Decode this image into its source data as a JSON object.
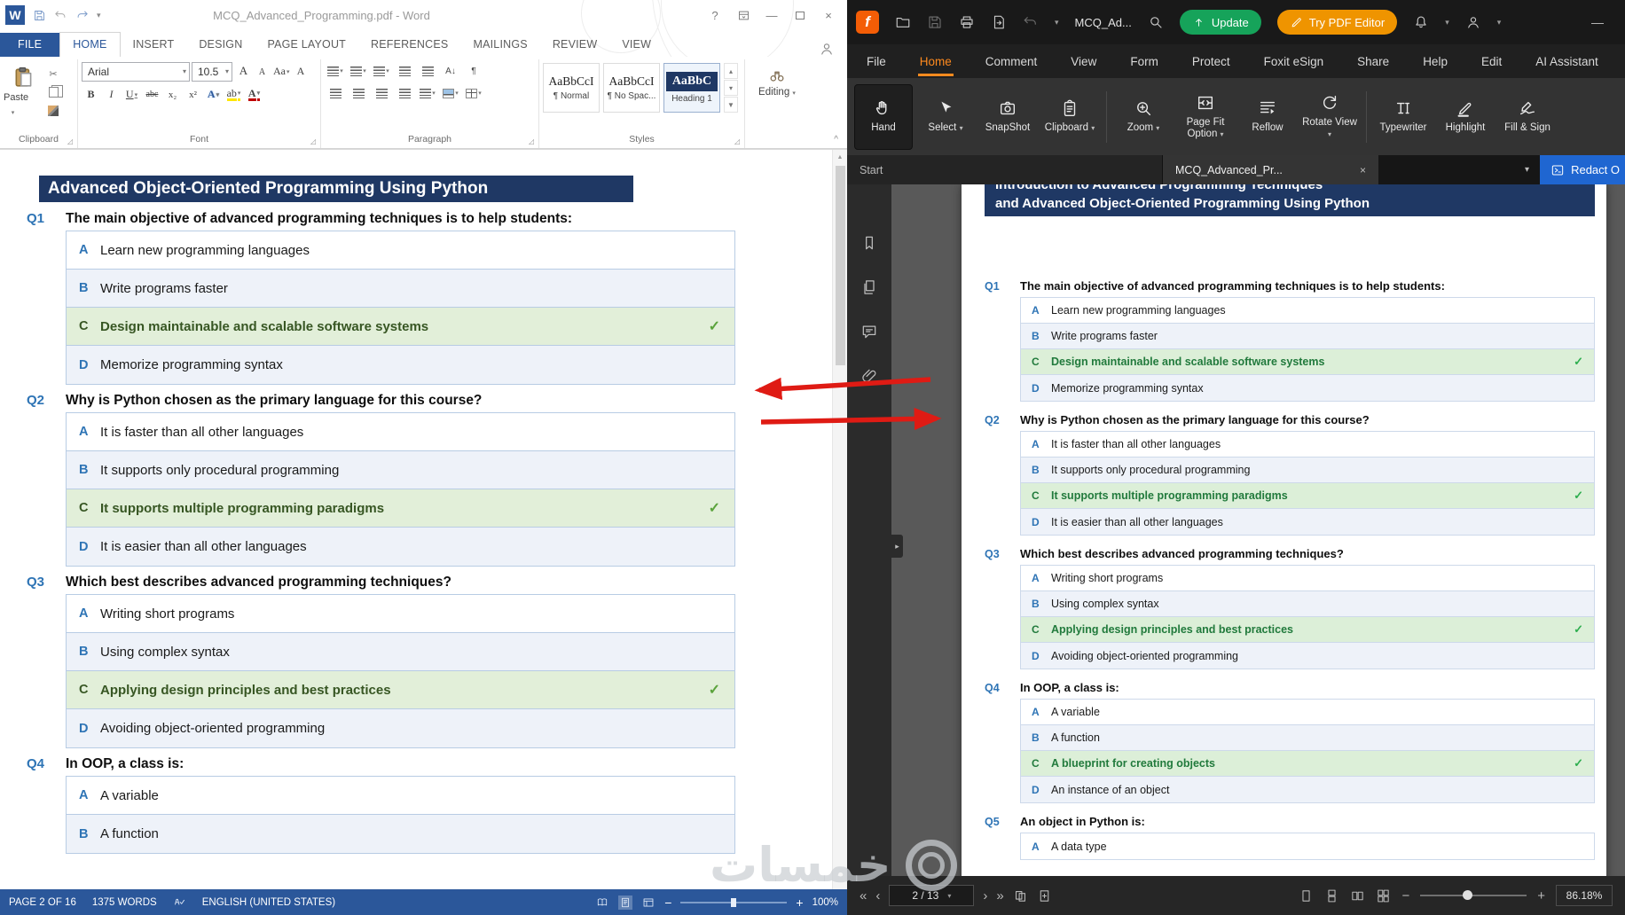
{
  "watermark": {
    "text": "خمسات"
  },
  "word": {
    "titlebar": {
      "logo": "W",
      "title": "MCQ_Advanced_Programming.pdf - Word",
      "help": "?"
    },
    "tabs": [
      "FILE",
      "HOME",
      "INSERT",
      "DESIGN",
      "PAGE LAYOUT",
      "REFERENCES",
      "MAILINGS",
      "REVIEW",
      "VIEW"
    ],
    "active_tab": "HOME",
    "ribbon": {
      "paste": "Paste",
      "groups": {
        "clipboard": "Clipboard",
        "font": "Font",
        "paragraph": "Paragraph",
        "styles": "Styles",
        "editing": "Editing"
      },
      "font_name": "Arial",
      "font_size": "10.5",
      "font_row1_buttons": [
        {
          "name": "grow-font",
          "glyph": "A"
        },
        {
          "name": "shrink-font",
          "glyph": "A"
        },
        {
          "name": "change-case",
          "glyph": "Aa",
          "caret": true
        },
        {
          "name": "clear-formatting",
          "glyph": "A"
        }
      ],
      "font_row2_buttons": [
        {
          "name": "bold",
          "glyph": "B"
        },
        {
          "name": "italic",
          "glyph": "I"
        },
        {
          "name": "underline",
          "glyph": "U",
          "caret": true
        },
        {
          "name": "strikethrough",
          "glyph": "abc"
        },
        {
          "name": "subscript",
          "glyph": "x₂"
        },
        {
          "name": "superscript",
          "glyph": "x²"
        },
        {
          "name": "text-effects",
          "glyph": "A",
          "caret": true
        },
        {
          "name": "highlight-color",
          "glyph": "ab",
          "caret": true
        },
        {
          "name": "font-color",
          "glyph": "A",
          "caret": true
        }
      ],
      "paragraph_row1_buttons": [
        {
          "name": "bullet-list",
          "icon": true,
          "caret": true
        },
        {
          "name": "numbered-list",
          "icon": true,
          "caret": true
        },
        {
          "name": "multilevel-list",
          "icon": true,
          "caret": true
        },
        {
          "name": "decrease-indent",
          "icon": true
        },
        {
          "name": "increase-indent",
          "icon": true
        },
        {
          "name": "sort",
          "glyph": "A↓"
        },
        {
          "name": "show-marks",
          "glyph": "¶"
        }
      ],
      "paragraph_row2_buttons": [
        {
          "name": "align-left",
          "icon": true
        },
        {
          "name": "align-center",
          "icon": true
        },
        {
          "name": "align-right",
          "icon": true
        },
        {
          "name": "justify",
          "icon": true
        },
        {
          "name": "line-spacing",
          "icon": true,
          "caret": true
        },
        {
          "name": "shading",
          "icon": true,
          "caret": true
        },
        {
          "name": "borders",
          "icon": true,
          "caret": true
        }
      ],
      "styles": [
        {
          "name": "normal",
          "preview": "AaBbCcI",
          "label": "¶ Normal"
        },
        {
          "name": "no-spacing",
          "preview": "AaBbCcI",
          "label": "¶ No Spac..."
        },
        {
          "name": "heading-1",
          "preview": "AaBbC",
          "label": "Heading 1",
          "selected": true
        }
      ]
    },
    "doc": {
      "title": "Advanced Object-Oriented Programming Using Python"
    },
    "status": {
      "page": "PAGE 2 OF 16",
      "words": "1375 WORDS",
      "language": "ENGLISH (UNITED STATES)",
      "zoom": "100%"
    }
  },
  "foxit": {
    "topbar": {
      "doc_switcher": "MCQ_Ad...",
      "update": "Update",
      "try_editor": "Try PDF Editor"
    },
    "menu": [
      "File",
      "Home",
      "Comment",
      "View",
      "Form",
      "Protect",
      "Foxit eSign",
      "Share",
      "Help",
      "Edit",
      "AI Assistant"
    ],
    "active_menu": "Home",
    "tools": [
      {
        "label": "Hand",
        "icon": "hand",
        "active": true
      },
      {
        "label": "Select",
        "icon": "select",
        "dropdown": true
      },
      {
        "label": "SnapShot",
        "icon": "snapshot"
      },
      {
        "label": "Clipboard",
        "icon": "clipboard",
        "dropdown": true,
        "sep_after": true
      },
      {
        "label": "Zoom",
        "icon": "zoom",
        "dropdown": true
      },
      {
        "label": "Page Fit Option",
        "icon": "pagefit",
        "dropdown": true
      },
      {
        "label": "Reflow",
        "icon": "reflow"
      },
      {
        "label": "Rotate View",
        "icon": "rotate",
        "dropdown": true,
        "sep_after": true
      },
      {
        "label": "Typewriter",
        "icon": "typewriter"
      },
      {
        "label": "Highlight",
        "icon": "highlight"
      },
      {
        "label": "Fill & Sign",
        "icon": "fillsign"
      }
    ],
    "tabs": {
      "start": "Start",
      "document": "MCQ_Advanced_Pr...",
      "redact": "Redact O"
    },
    "doc": {
      "title_line1": "Introduction to Advanced Programming Techniques",
      "title_line2": "and Advanced Object-Oriented Programming Using Python"
    },
    "status": {
      "page": "2 / 13",
      "zoom": "86.18%"
    }
  },
  "questions": [
    {
      "id": "Q1",
      "text": "The main objective of advanced programming techniques is to help students:",
      "options": [
        {
          "letter": "A",
          "text": "Learn new programming languages",
          "correct": false
        },
        {
          "letter": "B",
          "text": "Write programs faster",
          "correct": false
        },
        {
          "letter": "C",
          "text": "Design maintainable and scalable software systems",
          "correct": true
        },
        {
          "letter": "D",
          "text": "Memorize programming syntax",
          "correct": false
        }
      ]
    },
    {
      "id": "Q2",
      "text": "Why is Python chosen as the primary language for this course?",
      "options": [
        {
          "letter": "A",
          "text": "It is faster than all other languages",
          "correct": false
        },
        {
          "letter": "B",
          "text": "It supports only procedural programming",
          "correct": false
        },
        {
          "letter": "C",
          "text": "It supports multiple programming paradigms",
          "correct": true
        },
        {
          "letter": "D",
          "text": "It is easier than all other languages",
          "correct": false
        }
      ]
    },
    {
      "id": "Q3",
      "text": "Which best describes advanced programming techniques?",
      "options": [
        {
          "letter": "A",
          "text": "Writing short programs",
          "correct": false
        },
        {
          "letter": "B",
          "text": "Using complex syntax",
          "correct": false
        },
        {
          "letter": "C",
          "text": "Applying design principles and best practices",
          "correct": true
        },
        {
          "letter": "D",
          "text": "Avoiding object-oriented programming",
          "correct": false
        }
      ]
    },
    {
      "id": "Q4",
      "text": "In OOP, a class is:",
      "options": [
        {
          "letter": "A",
          "text": "A variable",
          "correct": false
        },
        {
          "letter": "B",
          "text": "A function",
          "correct": false
        },
        {
          "letter": "C",
          "text": "A blueprint for creating objects",
          "correct": true
        },
        {
          "letter": "D",
          "text": "An instance of an object",
          "correct": false
        }
      ]
    },
    {
      "id": "Q5",
      "text": "An object in Python is:",
      "options": [
        {
          "letter": "A",
          "text": "A data type",
          "correct": false
        }
      ]
    }
  ]
}
